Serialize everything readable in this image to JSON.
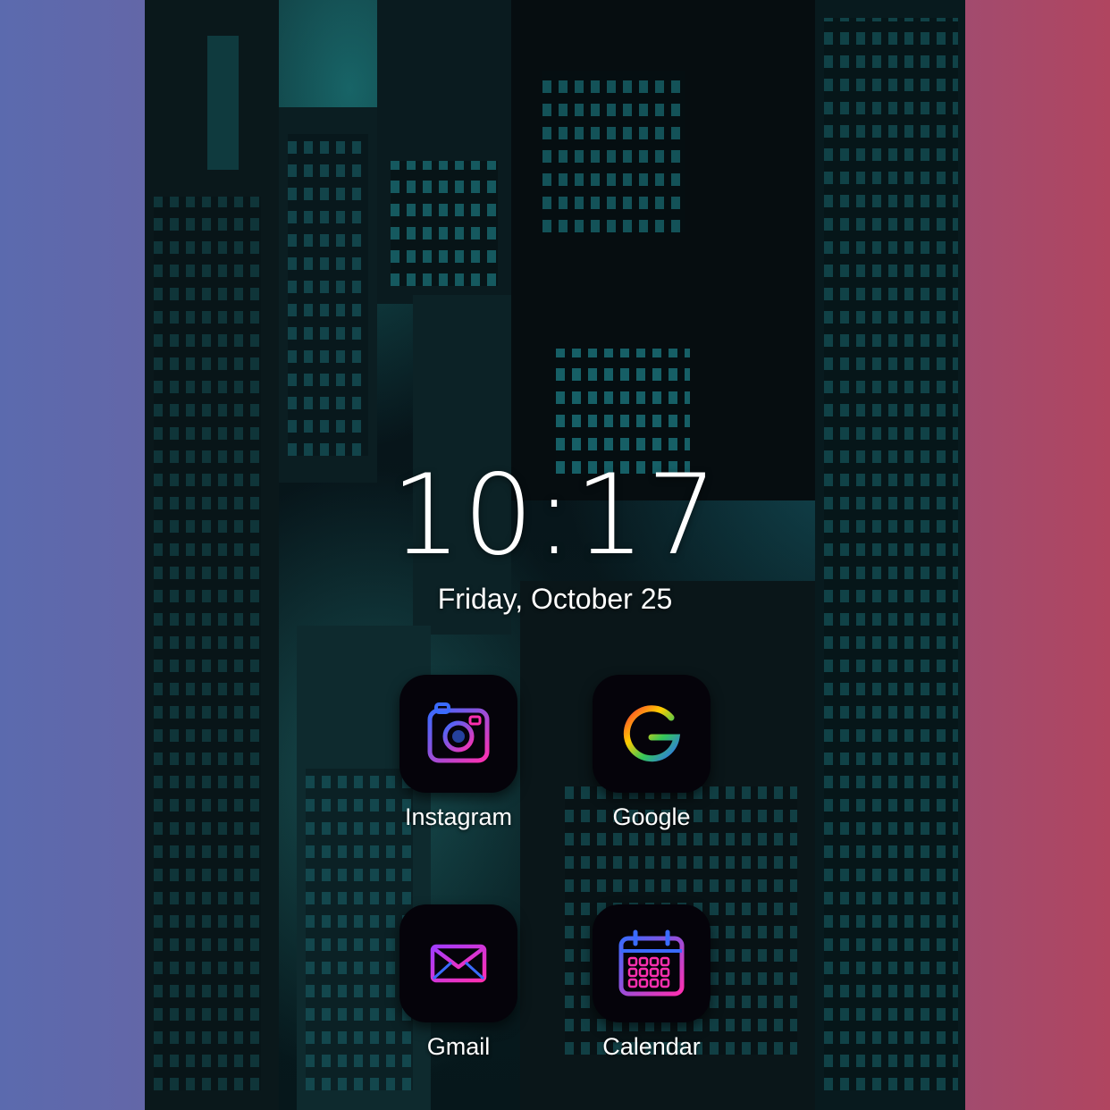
{
  "lockscreen": {
    "time": "10:17",
    "date": "Friday, October 25"
  },
  "apps": [
    {
      "label": "Instagram",
      "icon": "instagram-camera-icon"
    },
    {
      "label": "Google",
      "icon": "google-g-icon"
    },
    {
      "label": "Gmail",
      "icon": "mail-envelope-icon"
    },
    {
      "label": "Calendar",
      "icon": "calendar-icon"
    }
  ],
  "colors": {
    "neon_pink": "#ff2fb0",
    "neon_blue": "#3a6bff",
    "neon_purple": "#a23cff",
    "city_teal": "#1f8c94",
    "frame_left": "#5b6aae",
    "frame_right": "#b04560"
  }
}
